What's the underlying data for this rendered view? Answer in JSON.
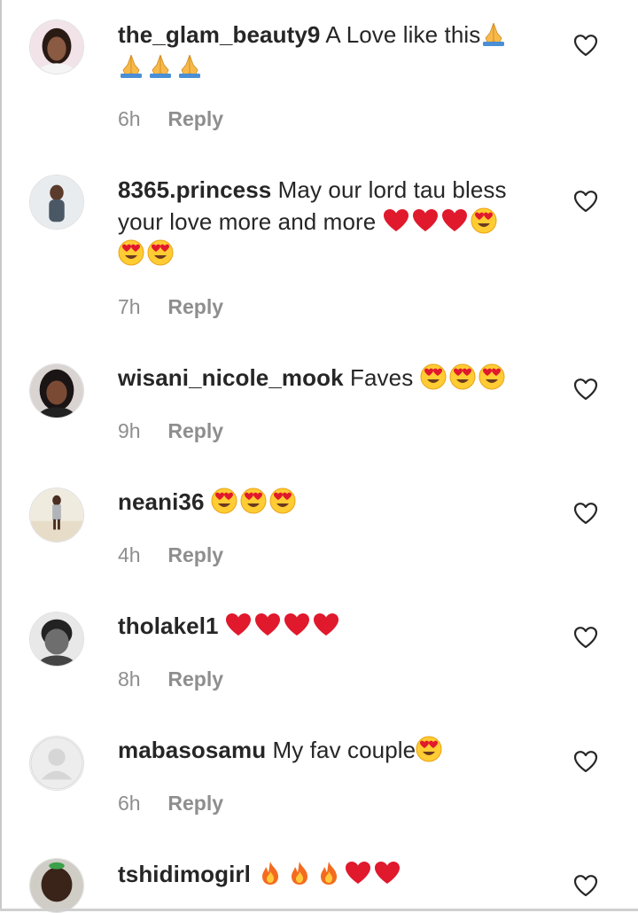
{
  "comments": [
    {
      "username": "the_glam_beauty9",
      "text": "A Love like this",
      "emojis": [
        "folded-hands",
        "folded-hands",
        "folded-hands",
        "folded-hands"
      ],
      "time": "6h",
      "reply": "Reply"
    },
    {
      "username": "8365.princess",
      "text": "May our lord tau bless your love more and more",
      "emojis": [
        "red-heart",
        "red-heart",
        "red-heart",
        "heart-eyes",
        "heart-eyes",
        "heart-eyes"
      ],
      "time": "7h",
      "reply": "Reply"
    },
    {
      "username": "wisani_nicole_mook",
      "text": "Faves",
      "emojis": [
        "heart-eyes",
        "heart-eyes",
        "heart-eyes"
      ],
      "time": "9h",
      "reply": "Reply"
    },
    {
      "username": "neani36",
      "text": "",
      "emojis": [
        "heart-eyes",
        "heart-eyes",
        "heart-eyes"
      ],
      "time": "4h",
      "reply": "Reply"
    },
    {
      "username": "tholakel1",
      "text": "",
      "emojis": [
        "red-heart",
        "red-heart",
        "red-heart",
        "red-heart"
      ],
      "time": "8h",
      "reply": "Reply"
    },
    {
      "username": "mabasosamu",
      "text": "My fav couple",
      "emojis": [
        "heart-eyes"
      ],
      "time": "6h",
      "reply": "Reply"
    },
    {
      "username": "tshidimogirl",
      "text": "",
      "emojis": [
        "fire",
        "fire",
        "fire",
        "red-heart",
        "red-heart"
      ],
      "time": "",
      "reply": ""
    }
  ],
  "colors": {
    "text": "#262626",
    "muted": "#8e8e8e",
    "heart": "#e0192d",
    "emoji": "#ffcc33"
  }
}
